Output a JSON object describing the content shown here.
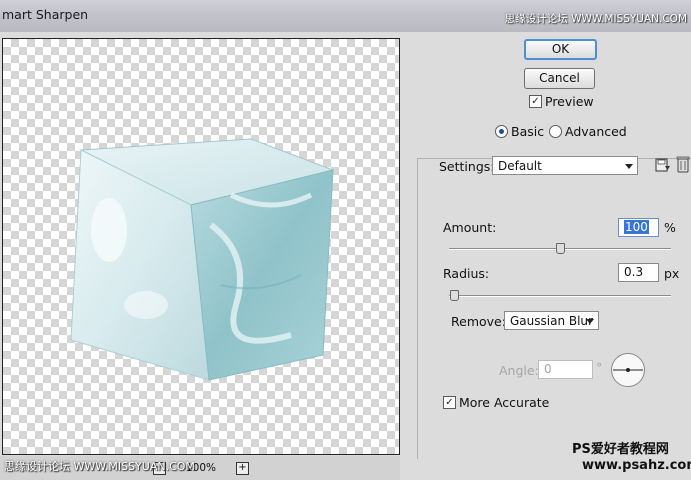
{
  "window": {
    "title": "mart Sharpen"
  },
  "watermarks": {
    "top_right": "思缘设计论坛 WWW.MISSYUAN.COM",
    "bottom_left": "思缘设计论坛 WWW.MISSYUAN.COM",
    "bottom_right_line1": "PS爱好者教程网",
    "bottom_right_line2": "www.psahz.com"
  },
  "preview": {
    "zoom_out": "−",
    "zoom_level": "100%",
    "zoom_in": "+"
  },
  "buttons": {
    "ok": "OK",
    "cancel": "Cancel"
  },
  "preview_toggle": {
    "label": "Preview",
    "checked": true
  },
  "mode": {
    "basic": "Basic",
    "advanced": "Advanced",
    "selected": "basic"
  },
  "settings": {
    "label": "Settings:",
    "value": "Default"
  },
  "amount": {
    "label": "Amount:",
    "value": "100",
    "unit": "%",
    "slider_fraction": 0.5
  },
  "radius": {
    "label": "Radius:",
    "value": "0.3",
    "unit": "px",
    "slider_fraction": 0.003
  },
  "remove": {
    "label": "Remove:",
    "value": "Gaussian Blur"
  },
  "angle": {
    "label": "Angle:",
    "value": "0",
    "unit": "°"
  },
  "more_accurate": {
    "label": "More Accurate",
    "checked": true
  },
  "colors": {
    "ok_border": "#4b8fd4",
    "selection": "#3875d7"
  }
}
